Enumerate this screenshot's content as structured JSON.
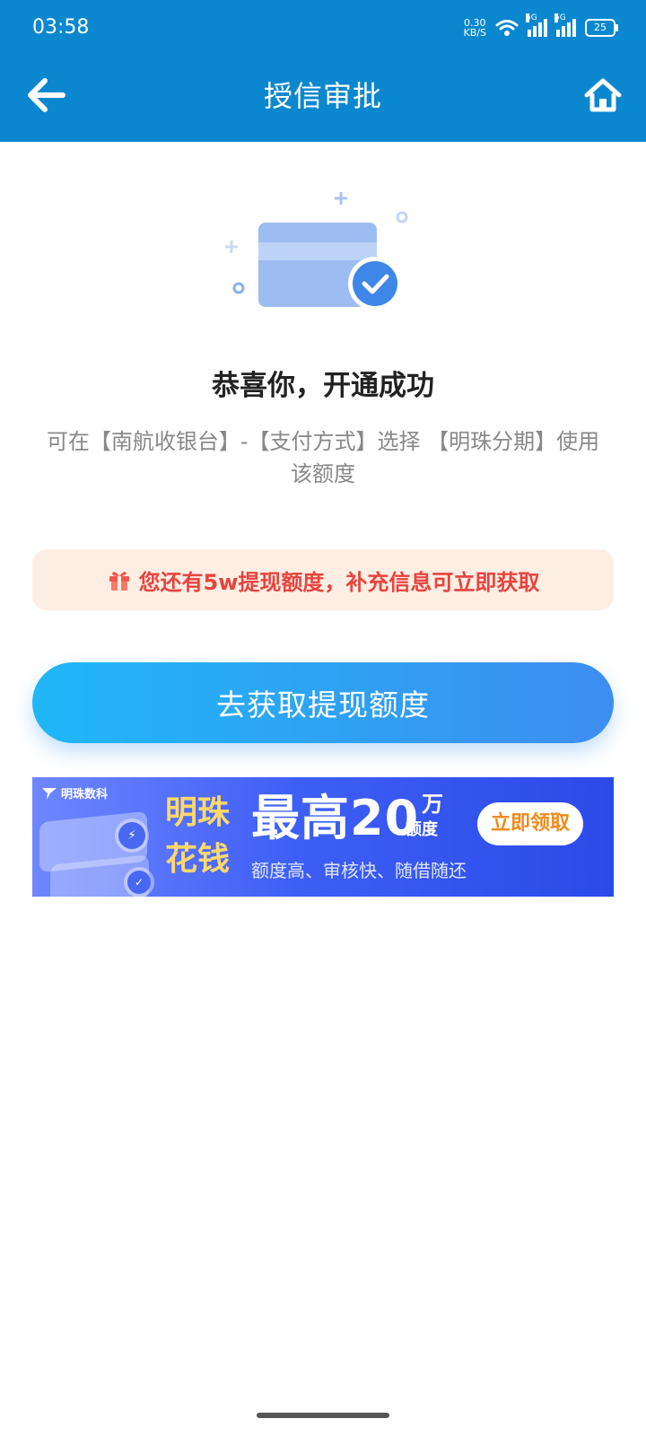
{
  "status_bar": {
    "time": "03:58",
    "net_speed_value": "0.30",
    "net_speed_unit": "KB/S",
    "signal_label": "5G",
    "battery": "25"
  },
  "header": {
    "title": "授信审批",
    "back_icon": "back-arrow-icon",
    "home_icon": "home-icon"
  },
  "result": {
    "title": "恭喜你，开通成功",
    "description": "可在【南航收银台】-【支付方式】选择 【明珠分期】使用该额度"
  },
  "tip": {
    "icon": "gift-icon",
    "text": "您还有5w提现额度，补充信息可立即获取"
  },
  "cta": {
    "label": "去获取提现额度"
  },
  "banner": {
    "logo_text": "明珠数科",
    "brand_line1": "明珠",
    "brand_line2": "花钱",
    "headline": "最高20",
    "unit_top": "万",
    "unit_bottom": "额度",
    "subtitle": "额度高、审核快、随借随还",
    "button": "立即领取"
  },
  "colors": {
    "header_bg": "#0a87cf",
    "cta_gradient_start": "#1fb7f6",
    "cta_gradient_end": "#3d8ef1",
    "tip_bg": "#fdeee3",
    "tip_text": "#e8433e"
  }
}
